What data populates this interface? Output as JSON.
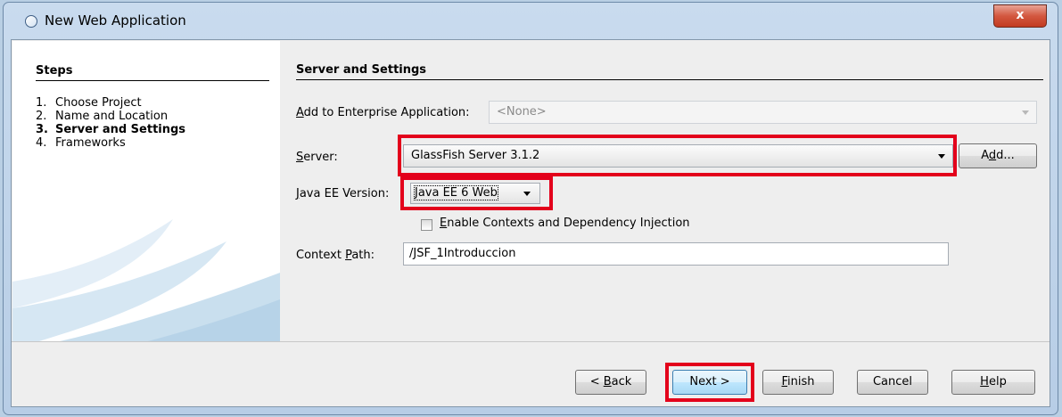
{
  "window": {
    "title": "New Web Application",
    "close_label": "x"
  },
  "steps": {
    "heading": "Steps",
    "items": [
      {
        "num": "1.",
        "label": "Choose Project"
      },
      {
        "num": "2.",
        "label": "Name and Location"
      },
      {
        "num": "3.",
        "label": "Server and Settings"
      },
      {
        "num": "4.",
        "label": "Frameworks"
      }
    ],
    "active_index": 2
  },
  "panel": {
    "title": "Server and Settings",
    "enterprise": {
      "label_key": "A",
      "label_rest": "dd to Enterprise Application:",
      "value": "<None>"
    },
    "server": {
      "label_key": "S",
      "label_rest": "erver:",
      "value": "GlassFish Server 3.1.2",
      "add_label_pre": "A",
      "add_label_key": "d",
      "add_label_post": "d..."
    },
    "java_ee": {
      "label_key": "J",
      "label_rest": "ava EE Version:",
      "value": "Java EE 6 Web"
    },
    "cdi": {
      "label_key": "E",
      "label_rest": "nable Contexts and Dependency Injection",
      "checked": false
    },
    "context_path": {
      "label_pre": "Context ",
      "label_key": "P",
      "label_post": "ath:",
      "value": "/JSF_1Introduccion"
    }
  },
  "buttons": {
    "back": {
      "pre": "< ",
      "key": "B",
      "post": "ack"
    },
    "next": "Next >",
    "finish": {
      "key": "F",
      "post": "inish"
    },
    "cancel": "Cancel",
    "help": {
      "key": "H",
      "post": "elp"
    }
  },
  "colors": {
    "highlight": "#e3001b",
    "window_frame": "#b9cfe4",
    "close_button": "#c23b21"
  }
}
